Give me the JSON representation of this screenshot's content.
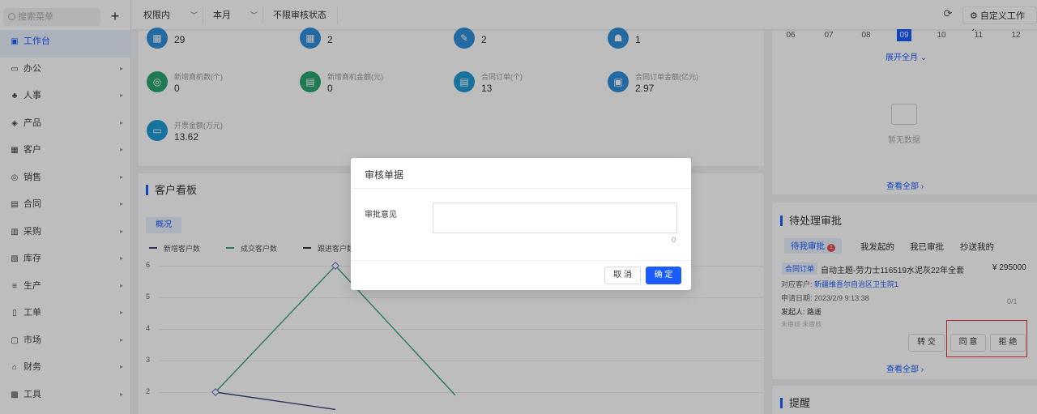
{
  "sidebar": {
    "search_placeholder": "搜索菜单",
    "add_label": "+",
    "items": [
      {
        "label": "工作台",
        "icon": "grid-icon",
        "glyph": "▣"
      },
      {
        "label": "办公",
        "icon": "monitor-icon",
        "glyph": "▭"
      },
      {
        "label": "人事",
        "icon": "people-icon",
        "glyph": "♣"
      },
      {
        "label": "产品",
        "icon": "box-icon",
        "glyph": "◈"
      },
      {
        "label": "客户",
        "icon": "customer-icon",
        "glyph": "▦"
      },
      {
        "label": "销售",
        "icon": "sales-icon",
        "glyph": "◎"
      },
      {
        "label": "合同",
        "icon": "contract-icon",
        "glyph": "▤"
      },
      {
        "label": "采购",
        "icon": "cart-icon",
        "glyph": "▥"
      },
      {
        "label": "库存",
        "icon": "warehouse-icon",
        "glyph": "▧"
      },
      {
        "label": "生产",
        "icon": "factory-icon",
        "glyph": "≡"
      },
      {
        "label": "工单",
        "icon": "ticket-icon",
        "glyph": "▯"
      },
      {
        "label": "市场",
        "icon": "market-icon",
        "glyph": "▢"
      },
      {
        "label": "财务",
        "icon": "finance-icon",
        "glyph": "⌂"
      },
      {
        "label": "工具",
        "icon": "tool-icon",
        "glyph": "▩"
      }
    ]
  },
  "topbar": {
    "filters": [
      "权限内",
      "本月",
      "不限审核状态"
    ],
    "custom_workbench": "自定义工作台"
  },
  "stats": [
    {
      "label": "",
      "value": "29",
      "color": "b"
    },
    {
      "label": "",
      "value": "2",
      "color": "b"
    },
    {
      "label": "",
      "value": "2",
      "color": "b"
    },
    {
      "label": "",
      "value": "1",
      "color": "b"
    },
    {
      "label": "新增商机数(个)",
      "value": "0",
      "color": "g"
    },
    {
      "label": "新增商机金额(元)",
      "value": "0",
      "color": "g"
    },
    {
      "label": "合同订单(个)",
      "value": "13",
      "color": "c"
    },
    {
      "label": "合同订单金额(亿元)",
      "value": "2.97",
      "color": "b"
    },
    {
      "label": "开票金额(万元)",
      "value": "13.62",
      "color": "c"
    }
  ],
  "customer_board": {
    "title": "客户看板",
    "tab": "概况",
    "legend": [
      "新增客户数",
      "成交客户数",
      "跟进客户数"
    ]
  },
  "chart_data": {
    "type": "line",
    "title": "",
    "xlabel": "",
    "ylabel": "",
    "yticks": [
      "6",
      "5",
      "4",
      "3",
      "2"
    ],
    "series": [
      {
        "name": "新增客户数",
        "color": "#3d4a7a",
        "points": [
          [
            0,
            2
          ],
          [
            1,
            1.45
          ]
        ]
      },
      {
        "name": "成交客户数",
        "color": "#3aa57a",
        "points": [
          [
            0,
            2
          ],
          [
            1,
            6
          ],
          [
            2,
            1.9
          ]
        ]
      }
    ]
  },
  "calendar": {
    "days": [
      "06",
      "07",
      "08",
      "09",
      "10",
      "11",
      "12"
    ],
    "selected": "09",
    "expand": "展开全月",
    "empty": "暂无数据",
    "view_all": "查看全部"
  },
  "approvals": {
    "title": "待处理审批",
    "tabs": [
      "待我审批",
      "我发起的",
      "我已审批",
      "抄送我的"
    ],
    "badge": "1",
    "item": {
      "tag": "合同订单",
      "name": "自动主题-劳力士116519水泥灰22年全套",
      "amount": "¥ 295000",
      "customer_label": "对应客户:",
      "customer": "新疆维吾尔自治区卫生院1",
      "date_label": "申请日期:",
      "date": "2023/2/9 9:13:38",
      "initiator_label": "发起人:",
      "initiator": "路遥",
      "status": "未审核 未审核",
      "pager": "0/1"
    },
    "transfer": "转 交",
    "agree": "同 意",
    "reject": "拒 绝",
    "view_all": "查看全部"
  },
  "reminder": {
    "title": "提醒"
  },
  "modal": {
    "title": "审核单据",
    "label": "审批意见",
    "value": "",
    "count": "0",
    "cancel": "取 消",
    "confirm": "确 定"
  }
}
